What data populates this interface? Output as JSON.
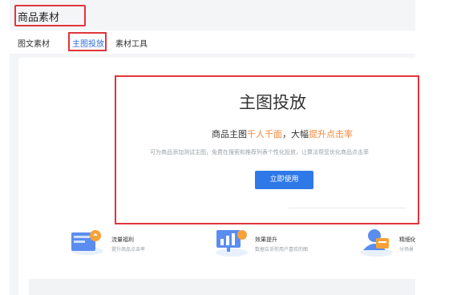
{
  "header": {
    "title": "商品素材"
  },
  "tabs": [
    {
      "label": "图文素材"
    },
    {
      "label": "主图投放"
    },
    {
      "label": "素材工具"
    }
  ],
  "hero": {
    "title": "主图投放",
    "subtitle_a": "商品主图",
    "subtitle_hl1": "千人千面",
    "subtitle_b": "，大幅",
    "subtitle_hl2": "提升点击率",
    "description": "可为商品添加测试主图，免费在搜索和推荐列表个性化投放，让算法帮您优化商品点击率",
    "cta_label": "立即使用"
  },
  "features": [
    {
      "title": "流量福利",
      "desc": "提升商品点击率",
      "icon": "traffic-icon"
    },
    {
      "title": "效果提升",
      "desc": "数据告诉你用户喜欢的图",
      "icon": "chart-screen-icon"
    },
    {
      "title": "精细化",
      "desc": "分场景",
      "icon": "user-profile-icon"
    }
  ],
  "colors": {
    "accent": "#2f78e8",
    "highlight": "#f5883a",
    "annotation": "#e0353b"
  }
}
